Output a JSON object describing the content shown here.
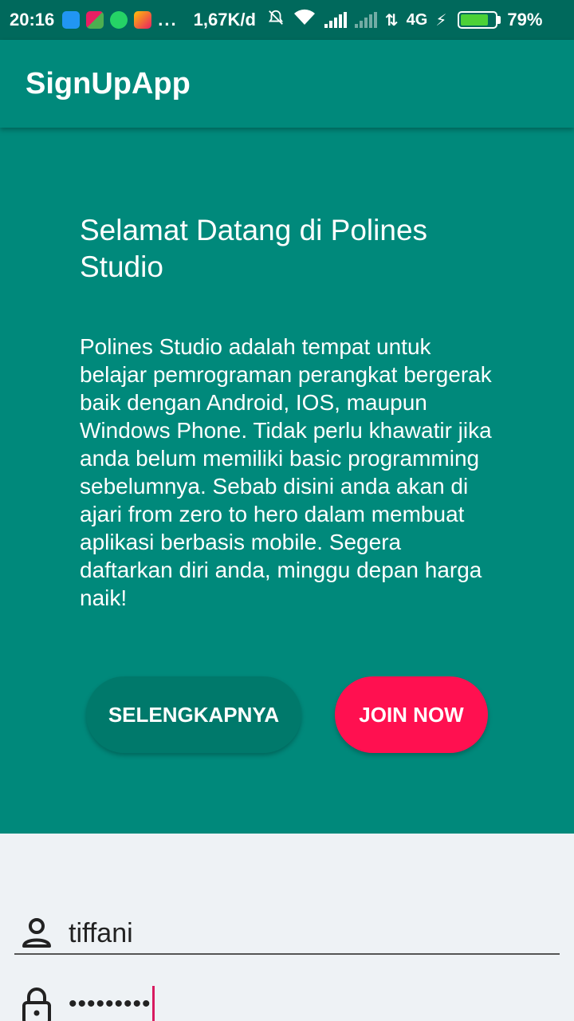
{
  "status_bar": {
    "time": "20:16",
    "more": "...",
    "network_speed": "1,67K/d",
    "network_type": "4G",
    "battery": "79%",
    "battery_level": 0.79
  },
  "app_bar": {
    "title": "SignUpApp"
  },
  "hero": {
    "title": "Selamat Datang di Polines Studio",
    "description": "Polines Studio adalah tempat untuk belajar pemrograman perangkat bergerak baik dengan Android, IOS, maupun Windows Phone. Tidak perlu khawatir jika anda belum memiliki basic programming sebelumnya. Sebab disini anda akan di ajari from zero to hero dalam membuat aplikasi berbasis mobile. Segera daftarkan diri anda, minggu depan harga naik!",
    "more_button": "SELENGKAPNYA",
    "join_button": "JOIN NOW"
  },
  "form": {
    "username_value": "tiffani",
    "password_value": "•••••••••",
    "user_icon": "person-icon",
    "password_icon": "lock-icon"
  },
  "colors": {
    "primary": "#00897b",
    "primary_dark": "#00695c",
    "accent": "#ff1050",
    "button_secondary": "#00796b",
    "form_background": "#eef2f5"
  }
}
